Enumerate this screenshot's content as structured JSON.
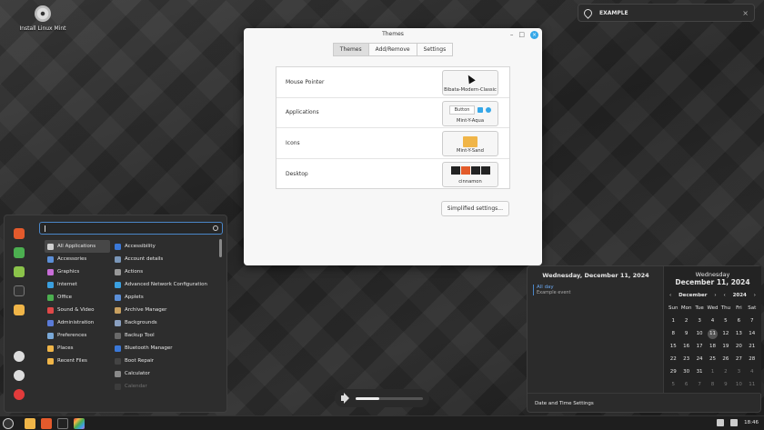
{
  "desktop": {
    "icon_label": "Install Linux Mint"
  },
  "notification": {
    "title": "EXAMPLE",
    "close": "×"
  },
  "themes_window": {
    "title": "Themes",
    "controls": {
      "minimize": "–",
      "maximize": "□",
      "close": "×"
    },
    "tabs": [
      "Themes",
      "Add/Remove",
      "Settings"
    ],
    "rows": [
      {
        "label": "Mouse Pointer",
        "value": "Bibata-Modern-Classic"
      },
      {
        "label": "Applications",
        "value": "Mint-Y-Aqua",
        "preview_button": "Button"
      },
      {
        "label": "Icons",
        "value": "Mint-Y-Sand"
      },
      {
        "label": "Desktop",
        "value": "cinnamon"
      }
    ],
    "simplified_button": "Simplified settings..."
  },
  "menu": {
    "search_placeholder": "",
    "categories": [
      {
        "label": "All Applications",
        "color": "#cfcfcf"
      },
      {
        "label": "Accessories",
        "color": "#5b8fd8"
      },
      {
        "label": "Graphics",
        "color": "#c86dd7"
      },
      {
        "label": "Internet",
        "color": "#3aa0e0"
      },
      {
        "label": "Office",
        "color": "#4caf50"
      },
      {
        "label": "Sound & Video",
        "color": "#e04848"
      },
      {
        "label": "Administration",
        "color": "#5a7bd8"
      },
      {
        "label": "Preferences",
        "color": "#7aa9d8"
      },
      {
        "label": "Places",
        "color": "#f0b548"
      },
      {
        "label": "Recent Files",
        "color": "#f0b548"
      }
    ],
    "apps": [
      {
        "label": "Accessibility",
        "color": "#3a78d8"
      },
      {
        "label": "Account details",
        "color": "#7a96b8"
      },
      {
        "label": "Actions",
        "color": "#999999"
      },
      {
        "label": "Advanced Network Configuration",
        "color": "#3aa0e0"
      },
      {
        "label": "Applets",
        "color": "#5b8fd8"
      },
      {
        "label": "Archive Manager",
        "color": "#c8a060"
      },
      {
        "label": "Backgrounds",
        "color": "#8aa0c0"
      },
      {
        "label": "Backup Tool",
        "color": "#6a6a6a"
      },
      {
        "label": "Bluetooth Manager",
        "color": "#3a78d8"
      },
      {
        "label": "Boot Repair",
        "color": "#444444"
      },
      {
        "label": "Calculator",
        "color": "#8a8a8a"
      },
      {
        "label": "Calendar",
        "color": "#5a5a5a"
      }
    ],
    "favorites_colors": [
      "#e45a2c",
      "#4caf50",
      "#8bc34a",
      "#333333",
      "#f0b548"
    ],
    "session_colors": [
      "#dddddd",
      "#dddddd",
      "#e23b3b"
    ]
  },
  "calendar": {
    "left_title": "Wednesday, December 11, 2024",
    "events": [
      {
        "time": "All day",
        "text": "Example event"
      }
    ],
    "day_name": "Wednesday",
    "date": "December 11, 2024",
    "month": "December",
    "year": "2024",
    "nav": {
      "prev": "‹",
      "next": "›"
    },
    "weekdays": [
      "Sun",
      "Mon",
      "Tue",
      "Wed",
      "Thu",
      "Fri",
      "Sat"
    ],
    "days": [
      [
        "1",
        "2",
        "3",
        "4",
        "5",
        "6",
        "7"
      ],
      [
        "8",
        "9",
        "10",
        "11",
        "12",
        "13",
        "14"
      ],
      [
        "15",
        "16",
        "17",
        "18",
        "19",
        "20",
        "21"
      ],
      [
        "22",
        "23",
        "24",
        "25",
        "26",
        "27",
        "28"
      ],
      [
        "29",
        "30",
        "31",
        "1",
        "2",
        "3",
        "4"
      ],
      [
        "5",
        "6",
        "7",
        "8",
        "9",
        "10",
        "11"
      ]
    ],
    "today": "11",
    "footer": "Date and Time Settings"
  },
  "volume": {
    "level_percent": 35
  },
  "taskbar": {
    "time": "18:46"
  }
}
